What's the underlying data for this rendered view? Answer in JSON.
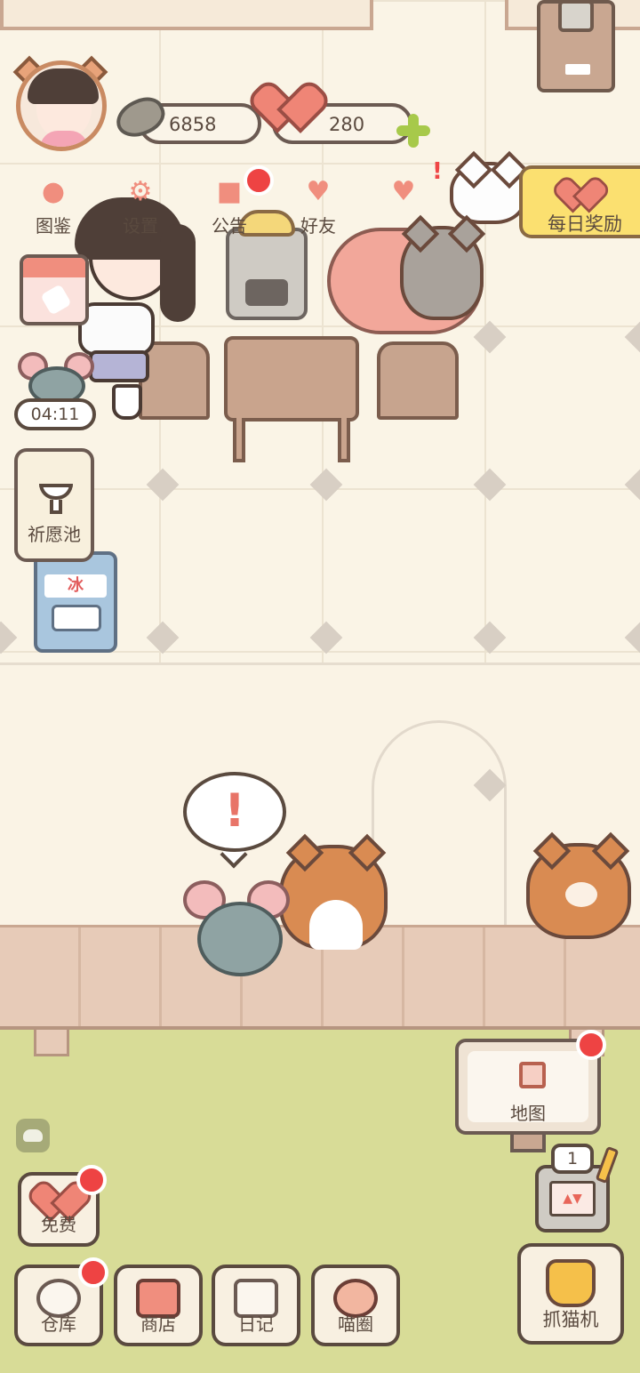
{
  "resources": {
    "fish_count": "6858",
    "heart_count": "280"
  },
  "top_menu": [
    {
      "label": "图鉴",
      "icon": "cat-book-icon"
    },
    {
      "label": "设置",
      "icon": "gear-icon"
    },
    {
      "label": "公告",
      "icon": "gift-icon"
    },
    {
      "label": "好友",
      "icon": "friends-icon"
    }
  ],
  "daily_reward": {
    "label": "每日奖励",
    "icon": "heart-fish-icon"
  },
  "event_timer": "04:11",
  "wishing_pool": {
    "label": "祈愿池",
    "icon": "fountain-icon"
  },
  "speech_mark": "!",
  "map_sign": {
    "label": "地图",
    "icon": "house-icon"
  },
  "vending": {
    "count": "1"
  },
  "bottom_buttons": {
    "free": "免费",
    "warehouse": "仓库",
    "shop": "商店",
    "diary": "日记",
    "meow_circle": "喵圈",
    "claw_machine": "抓猫机"
  },
  "colors": {
    "accent": "#f08e7e",
    "badge": "#ee4343",
    "plus": "#a7c94a",
    "daily_bg": "#fbe070",
    "grass": "#d8dc97"
  }
}
